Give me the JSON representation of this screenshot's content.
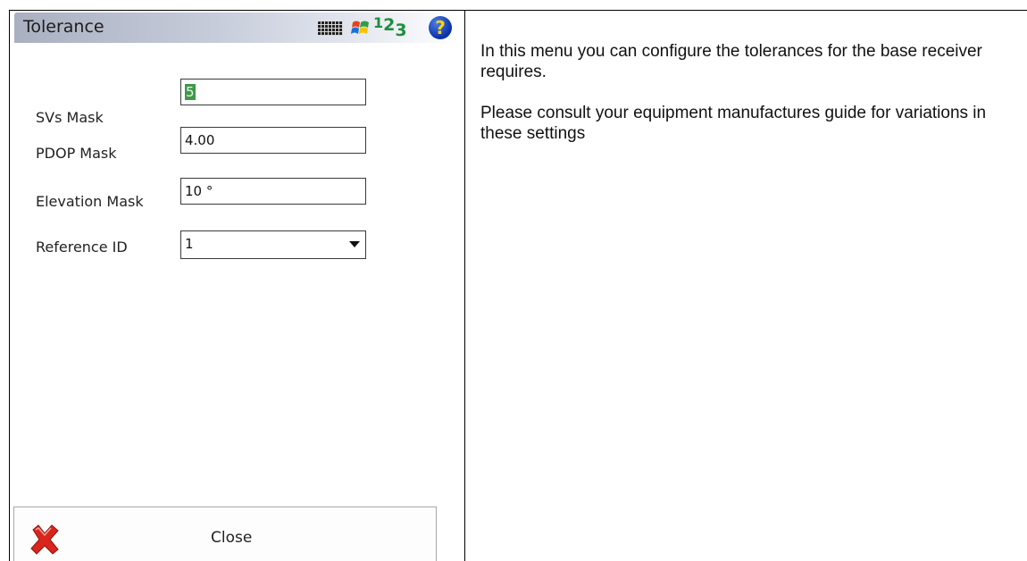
{
  "window": {
    "title": "Tolerance",
    "status_icons": [
      "keyboard-icon",
      "windows-flag-icon",
      "input-mode-icon",
      "help-icon"
    ],
    "input_mode_parts": [
      "1",
      "2",
      "3"
    ],
    "help_glyph": "?"
  },
  "form": {
    "fields": [
      {
        "label": "SVs Mask",
        "value": "5",
        "selected": true
      },
      {
        "label": "PDOP Mask",
        "value": "4.00"
      },
      {
        "label": "Elevation Mask",
        "value": "10 °"
      },
      {
        "label": "Reference ID",
        "value": "1",
        "type": "dropdown"
      }
    ]
  },
  "footer": {
    "close_label": "Close",
    "close_icon": "red-x-icon"
  },
  "help": {
    "paragraphs": [
      "In this menu you can configure the tolerances for the base receiver requires.",
      "Please consult your equipment manufactures guide for variations in these settings"
    ]
  },
  "colors": {
    "title_gradient_start": "#a9b0c0",
    "selection_highlight": "#3c9a4a",
    "input_mode_green": "#1e8f3a",
    "help_blue": "#0b2fa8",
    "close_red": "#d9251c"
  }
}
